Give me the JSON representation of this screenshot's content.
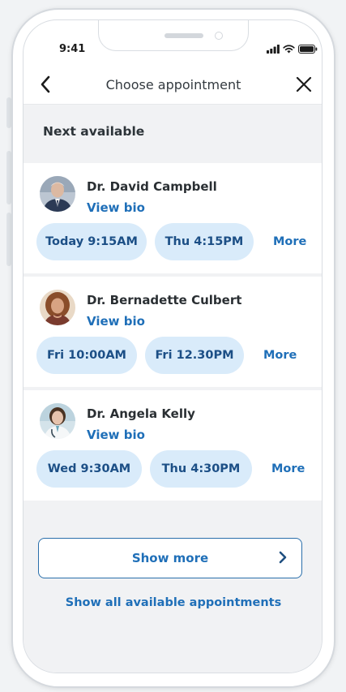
{
  "status_bar": {
    "time": "9:41"
  },
  "header": {
    "title": "Choose appointment"
  },
  "section": {
    "title": "Next available"
  },
  "doctors": [
    {
      "name": "Dr. David Campbell",
      "bio_label": "View bio",
      "slots": [
        "Today 9:15AM",
        "Thu 4:15PM"
      ],
      "more_label": "More"
    },
    {
      "name": "Dr. Bernadette Culbert",
      "bio_label": "View bio",
      "slots": [
        "Fri 10:00AM",
        "Fri 12.30PM"
      ],
      "more_label": "More"
    },
    {
      "name": "Dr. Angela Kelly",
      "bio_label": "View bio",
      "slots": [
        "Wed 9:30AM",
        "Thu 4:30PM"
      ],
      "more_label": "More"
    }
  ],
  "footer": {
    "show_more_label": "Show more",
    "show_all_label": "Show all available appointments"
  },
  "colors": {
    "accent": "#1f6fb8",
    "slot_background": "#d9ebfa",
    "slot_text": "#1c4f86",
    "list_background": "#f1f2f4"
  }
}
